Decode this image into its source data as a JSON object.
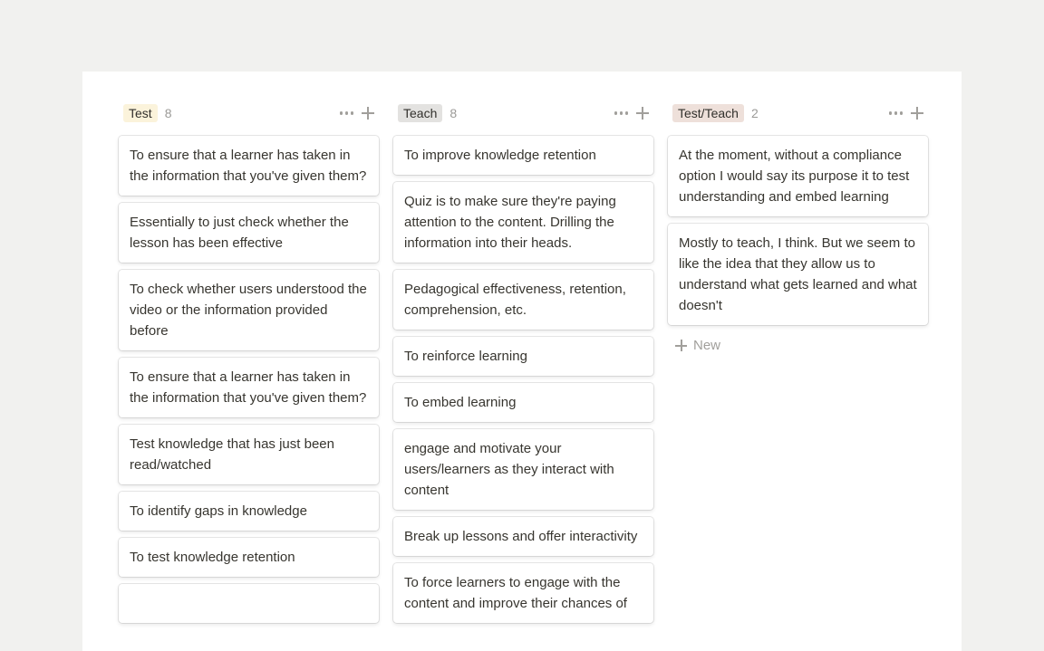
{
  "columns": [
    {
      "tag": "Test",
      "tag_color": "#fbf3db",
      "count": "8",
      "cards": [
        "To ensure that a learner has taken in the information that you've given them?",
        "Essentially to just check whether the lesson has been effective",
        "To check whether users understood the video or the information provided before",
        "To ensure that a learner has taken in the information that you've given them?",
        "Test knowledge that has just been read/watched",
        "To identify gaps in knowledge",
        "To test knowledge retention"
      ]
    },
    {
      "tag": "Teach",
      "tag_color": "#e3e2e0",
      "count": "8",
      "cards": [
        "To improve knowledge retention",
        "Quiz is to make sure they're paying attention to the content. Drilling the information into their heads.",
        "Pedagogical effectiveness, retention, comprehension, etc.",
        "To reinforce learning",
        "To embed learning",
        "engage and motivate your users/learners as they interact with content",
        "Break up lessons and offer interactivity",
        "To force learners to engage with the content and improve their chances of"
      ]
    },
    {
      "tag": "Test/Teach",
      "tag_color": "#eee0da",
      "count": "2",
      "cards": [
        "At the moment, without a compliance option I would say its purpose it to test understanding and embed learning",
        "Mostly to teach, I think. But we seem to like the idea that they allow us to understand what gets learned and what doesn't"
      ],
      "new_label": "New"
    }
  ]
}
